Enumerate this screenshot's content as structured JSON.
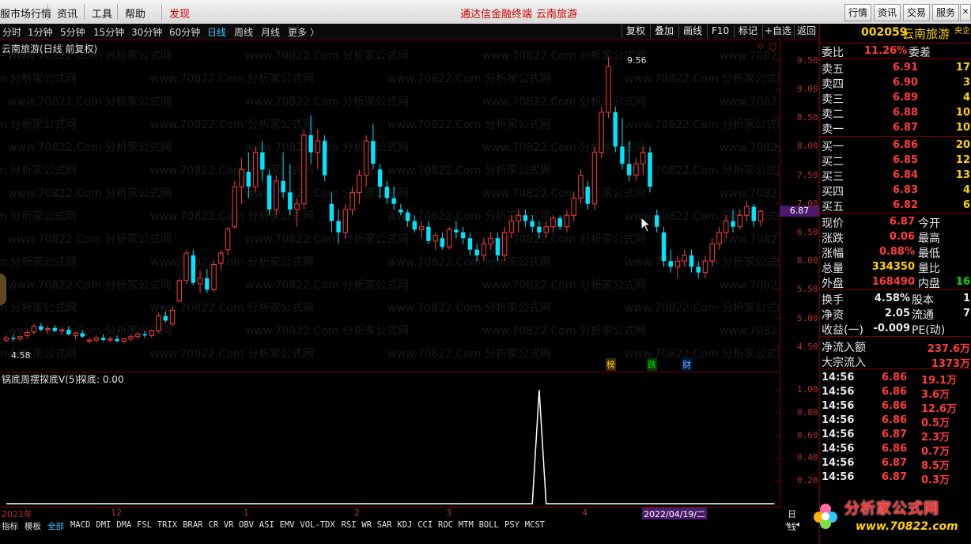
{
  "menubar": {
    "items": [
      "服市场行情",
      "资讯",
      "工具",
      "帮助",
      "发现"
    ],
    "center_title": "通达信金融终端",
    "center_stock": "云南旅游",
    "right_buttons": [
      "行情",
      "资讯",
      "交易",
      "服务"
    ]
  },
  "toolbar": {
    "periods": [
      "分时",
      "1分钟",
      "5分钟",
      "15分钟",
      "30分钟",
      "60分钟",
      "日线",
      "周线",
      "月线",
      "更多 〉"
    ],
    "active_period": "日线",
    "buttons": [
      "复权",
      "叠加",
      "画线",
      "F10",
      "标记",
      "+自选",
      "返回"
    ]
  },
  "chart": {
    "title": "云南旅游(日线 前复权)",
    "y_ticks": [
      "9.50",
      "9.00",
      "8.50",
      "8.00",
      "7.50",
      "7.00",
      "6.50",
      "6.00",
      "5.50",
      "5.00",
      "4.50"
    ],
    "price_tag": "6.87",
    "high_label": "9.56",
    "low_label": "4.58",
    "markers": [
      "榜",
      "跌",
      "财"
    ]
  },
  "indicator": {
    "title": "锅底周摆探底V(5)",
    "value_label": "探底: 0.00",
    "y_ticks": [
      "1.00",
      "0.80",
      "0.60",
      "0.40",
      "0.20"
    ]
  },
  "datebar": {
    "labels": [
      "2021年",
      "12",
      "1",
      "2",
      "3",
      "4"
    ],
    "highlight": "2022/04/19/二",
    "right": "日线"
  },
  "tabs": [
    "指标",
    "模板",
    "全部",
    "MACD",
    "DMI",
    "DMA",
    "FSL",
    "TRIX",
    "BRAR",
    "CR",
    "VR",
    "OBV",
    "ASI",
    "EMV",
    "VOL-TDX",
    "RSI",
    "WR",
    "SAR",
    "KDJ",
    "CCI",
    "ROC",
    "MTM",
    "BOLL",
    "PSY",
    "MCST"
  ],
  "active_tab": "全部",
  "panel": {
    "code": "002059",
    "name": "云南旅游",
    "tag": "央企",
    "weibi_label": "委比",
    "weibi_value": "11.26%",
    "weicha_label": "委差",
    "asks": [
      {
        "label": "卖五",
        "price": "6.91",
        "vol": "17"
      },
      {
        "label": "卖四",
        "price": "6.90",
        "vol": "3"
      },
      {
        "label": "卖三",
        "price": "6.89",
        "vol": "4"
      },
      {
        "label": "卖二",
        "price": "6.88",
        "vol": "10"
      },
      {
        "label": "卖一",
        "price": "6.87",
        "vol": "10"
      }
    ],
    "bids": [
      {
        "label": "买一",
        "price": "6.86",
        "vol": "20"
      },
      {
        "label": "买二",
        "price": "6.85",
        "vol": "12"
      },
      {
        "label": "买三",
        "price": "6.84",
        "vol": "13"
      },
      {
        "label": "买四",
        "price": "6.83",
        "vol": "4"
      },
      {
        "label": "买五",
        "price": "6.82",
        "vol": "6"
      }
    ],
    "quote": [
      {
        "l1": "现价",
        "v1": "6.87",
        "l2": "今开",
        "c": "red"
      },
      {
        "l1": "涨跌",
        "v1": "0.06",
        "l2": "最高",
        "c": "red"
      },
      {
        "l1": "涨幅",
        "v1": "0.88%",
        "l2": "最低",
        "c": "red"
      },
      {
        "l1": "总量",
        "v1": "334350",
        "l2": "量比",
        "c": "yel"
      },
      {
        "l1": "外盘",
        "v1": "168490",
        "l2": "内盘",
        "c": "red"
      }
    ],
    "neipan_tail": "16",
    "stats": [
      {
        "l1": "换手",
        "v1": "4.58%",
        "l2": "股本",
        "t": "1"
      },
      {
        "l1": "净资",
        "v1": "2.05",
        "l2": "流通",
        "t": "7"
      },
      {
        "l1": "收益(一)",
        "v1": "-0.009",
        "l2": "PE(动)",
        "t": ""
      }
    ],
    "flows": [
      {
        "label": "净流入额",
        "value": "237.6万"
      },
      {
        "label": "大宗流入",
        "value": "1373万"
      }
    ],
    "ticks": [
      {
        "t": "14:56",
        "p": "6.86",
        "v": "19.1万",
        "c": "red"
      },
      {
        "t": "14:56",
        "p": "6.86",
        "v": "3.6万",
        "c": "red"
      },
      {
        "t": "14:56",
        "p": "6.86",
        "v": "12.6万",
        "c": "red"
      },
      {
        "t": "14:56",
        "p": "6.86",
        "v": "0.5万",
        "c": "red"
      },
      {
        "t": "14:56",
        "p": "6.87",
        "v": "2.3万",
        "c": "red"
      },
      {
        "t": "14:56",
        "p": "6.86",
        "v": "0.7万",
        "c": "red"
      },
      {
        "t": "14:56",
        "p": "6.87",
        "v": "8.5万",
        "c": "red"
      },
      {
        "t": "14:56",
        "p": "6.87",
        "v": "0.3万",
        "c": "red"
      }
    ]
  },
  "logo": {
    "text": "分析家公式网",
    "url_text": "www.70822.com"
  },
  "watermark": "www.70822.Com 分析家公式网",
  "colors": {
    "up": "#ff3c3c",
    "down": "#00e5ff",
    "axis": "#7a0000",
    "ind_line": "#ffffff"
  },
  "chart_data": {
    "type": "candlestick",
    "ylim": [
      4.4,
      9.65
    ],
    "ohlc": [
      [
        4.62,
        4.7,
        4.58,
        4.66
      ],
      [
        4.66,
        4.72,
        4.6,
        4.64
      ],
      [
        4.64,
        4.7,
        4.6,
        4.68
      ],
      [
        4.7,
        4.8,
        4.65,
        4.75
      ],
      [
        4.76,
        4.9,
        4.72,
        4.86
      ],
      [
        4.86,
        4.92,
        4.78,
        4.8
      ],
      [
        4.8,
        4.86,
        4.74,
        4.82
      ],
      [
        4.83,
        4.88,
        4.76,
        4.78
      ],
      [
        4.78,
        4.84,
        4.72,
        4.8
      ],
      [
        4.8,
        4.86,
        4.7,
        4.72
      ],
      [
        4.7,
        4.76,
        4.64,
        4.74
      ],
      [
        4.74,
        4.8,
        4.66,
        4.68
      ],
      [
        4.6,
        4.66,
        4.56,
        4.62
      ],
      [
        4.62,
        4.7,
        4.58,
        4.66
      ],
      [
        4.66,
        4.72,
        4.6,
        4.62
      ],
      [
        4.62,
        4.68,
        4.58,
        4.64
      ],
      [
        4.64,
        4.7,
        4.58,
        4.6
      ],
      [
        4.6,
        4.66,
        4.56,
        4.64
      ],
      [
        4.64,
        4.72,
        4.6,
        4.68
      ],
      [
        4.68,
        4.76,
        4.64,
        4.72
      ],
      [
        4.72,
        4.78,
        4.66,
        4.7
      ],
      [
        4.7,
        4.8,
        4.66,
        4.78
      ],
      [
        4.78,
        5.1,
        4.74,
        5.04
      ],
      [
        5.04,
        5.12,
        4.92,
        4.96
      ],
      [
        4.9,
        5.2,
        4.86,
        5.14
      ],
      [
        5.3,
        5.7,
        5.28,
        5.66
      ],
      [
        5.66,
        6.2,
        5.6,
        6.14
      ],
      [
        6.1,
        6.2,
        5.58,
        5.62
      ],
      [
        5.6,
        5.84,
        5.44,
        5.7
      ],
      [
        5.7,
        5.86,
        5.44,
        5.5
      ],
      [
        5.5,
        6.0,
        5.46,
        5.94
      ],
      [
        5.96,
        6.2,
        5.84,
        6.14
      ],
      [
        6.2,
        6.6,
        6.1,
        6.56
      ],
      [
        6.6,
        7.4,
        6.56,
        7.3
      ],
      [
        7.3,
        7.8,
        7.0,
        7.6
      ],
      [
        7.56,
        7.9,
        7.1,
        7.3
      ],
      [
        7.3,
        8.0,
        7.2,
        7.9
      ],
      [
        7.9,
        8.1,
        7.4,
        7.6
      ],
      [
        7.5,
        7.6,
        6.8,
        6.9
      ],
      [
        6.9,
        7.5,
        6.8,
        7.4
      ],
      [
        7.4,
        7.9,
        7.1,
        7.2
      ],
      [
        7.2,
        7.7,
        6.8,
        6.9
      ],
      [
        6.9,
        7.1,
        6.6,
        7.0
      ],
      [
        7.0,
        8.3,
        6.9,
        8.2
      ],
      [
        8.2,
        8.55,
        7.7,
        7.9
      ],
      [
        7.9,
        8.3,
        7.6,
        8.1
      ],
      [
        8.1,
        8.2,
        7.4,
        7.5
      ],
      [
        7.0,
        7.2,
        6.5,
        6.7
      ],
      [
        6.7,
        6.9,
        6.3,
        6.5
      ],
      [
        6.5,
        7.0,
        6.4,
        6.9
      ],
      [
        6.9,
        7.3,
        6.8,
        7.2
      ],
      [
        7.2,
        7.6,
        7.0,
        7.5
      ],
      [
        7.5,
        8.2,
        7.3,
        8.1
      ],
      [
        8.1,
        8.4,
        7.6,
        7.7
      ],
      [
        7.6,
        7.7,
        7.1,
        7.3
      ],
      [
        7.3,
        7.4,
        7.0,
        7.1
      ],
      [
        7.1,
        7.3,
        6.9,
        7.0
      ],
      [
        6.9,
        7.0,
        6.8,
        6.85
      ],
      [
        6.85,
        6.9,
        6.6,
        6.7
      ],
      [
        6.7,
        6.8,
        6.5,
        6.55
      ],
      [
        6.55,
        6.7,
        6.4,
        6.6
      ],
      [
        6.6,
        6.7,
        6.3,
        6.35
      ],
      [
        6.35,
        6.5,
        6.2,
        6.45
      ],
      [
        6.4,
        6.5,
        6.2,
        6.25
      ],
      [
        6.25,
        6.6,
        6.2,
        6.55
      ],
      [
        6.55,
        6.7,
        6.4,
        6.5
      ],
      [
        6.5,
        6.6,
        6.3,
        6.4
      ],
      [
        6.4,
        6.5,
        6.1,
        6.2
      ],
      [
        6.2,
        6.3,
        6.0,
        6.1
      ],
      [
        6.1,
        6.4,
        6.0,
        6.3
      ],
      [
        6.3,
        6.5,
        6.2,
        6.4
      ],
      [
        6.4,
        6.5,
        6.0,
        6.1
      ],
      [
        6.1,
        6.6,
        6.0,
        6.5
      ],
      [
        6.5,
        6.8,
        6.4,
        6.7
      ],
      [
        6.7,
        6.9,
        6.5,
        6.8
      ],
      [
        6.8,
        6.9,
        6.6,
        6.7
      ],
      [
        6.7,
        6.8,
        6.5,
        6.6
      ],
      [
        6.6,
        6.7,
        6.4,
        6.5
      ],
      [
        6.5,
        6.7,
        6.4,
        6.6
      ],
      [
        6.6,
        6.8,
        6.5,
        6.75
      ],
      [
        6.75,
        6.8,
        6.55,
        6.6
      ],
      [
        6.6,
        6.9,
        6.5,
        6.8
      ],
      [
        6.8,
        7.2,
        6.7,
        7.1
      ],
      [
        7.1,
        7.6,
        7.0,
        7.5
      ],
      [
        7.3,
        7.4,
        6.9,
        7.0
      ],
      [
        7.0,
        8.0,
        6.9,
        7.9
      ],
      [
        7.9,
        8.7,
        7.8,
        8.6
      ],
      [
        8.6,
        9.56,
        8.5,
        9.4
      ],
      [
        8.6,
        8.7,
        7.9,
        8.0
      ],
      [
        8.0,
        8.5,
        7.6,
        7.7
      ],
      [
        7.7,
        8.1,
        7.4,
        7.5
      ],
      [
        7.5,
        7.8,
        7.4,
        7.7
      ],
      [
        7.7,
        8.0,
        7.5,
        7.9
      ],
      [
        7.9,
        8.0,
        7.2,
        7.3
      ],
      [
        6.8,
        6.9,
        6.5,
        6.6
      ],
      [
        6.5,
        6.6,
        5.9,
        6.0
      ],
      [
        6.0,
        6.2,
        5.8,
        5.9
      ],
      [
        5.9,
        6.1,
        5.7,
        6.0
      ],
      [
        6.0,
        6.2,
        5.9,
        6.1
      ],
      [
        6.1,
        6.2,
        5.8,
        5.9
      ],
      [
        5.9,
        6.0,
        5.7,
        5.8
      ],
      [
        5.8,
        6.1,
        5.7,
        6.0
      ],
      [
        6.0,
        6.4,
        5.9,
        6.3
      ],
      [
        6.3,
        6.6,
        6.2,
        6.5
      ],
      [
        6.5,
        6.8,
        6.4,
        6.7
      ],
      [
        6.7,
        6.9,
        6.5,
        6.6
      ],
      [
        6.6,
        6.9,
        6.55,
        6.8
      ],
      [
        6.8,
        7.05,
        6.7,
        6.95
      ],
      [
        6.95,
        7.0,
        6.6,
        6.7
      ],
      [
        6.7,
        6.9,
        6.6,
        6.87
      ]
    ],
    "indicator_values": [
      0,
      0,
      0,
      0,
      0,
      0,
      0,
      0,
      0,
      0,
      0,
      0,
      0,
      0,
      0,
      0,
      0,
      0,
      0,
      0,
      0,
      0,
      0,
      0,
      0,
      0,
      0,
      0,
      0,
      0,
      0,
      0,
      0,
      0,
      0,
      0,
      0,
      0,
      0,
      0,
      0,
      0,
      0,
      0,
      0,
      0,
      0,
      0,
      0,
      0,
      0,
      0,
      0,
      0,
      0,
      0,
      0,
      0,
      0,
      0,
      0,
      0,
      0,
      0,
      0,
      0,
      0,
      0,
      0,
      0,
      0,
      0,
      0,
      0,
      0,
      0,
      0,
      1,
      0,
      0,
      0,
      0,
      0,
      0,
      0,
      0,
      0,
      0,
      0,
      0,
      0,
      0,
      0,
      0,
      0,
      0,
      0,
      0,
      0,
      0,
      0,
      0,
      0,
      0,
      0,
      0,
      0,
      0,
      0,
      0,
      0,
      0
    ],
    "indicator_ylim": [
      0,
      1.05
    ]
  }
}
